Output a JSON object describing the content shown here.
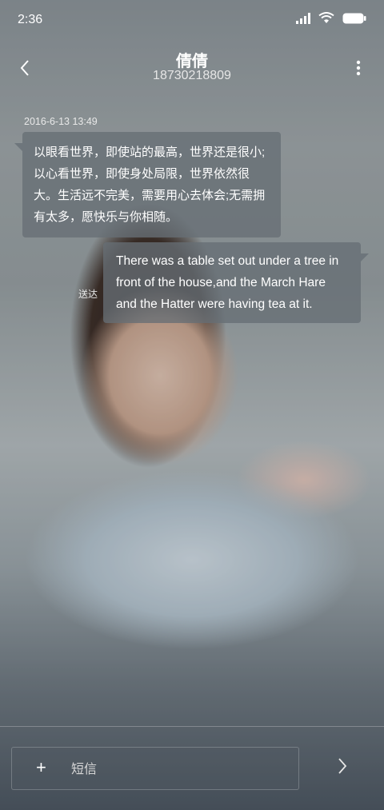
{
  "status_bar": {
    "time": "2:36",
    "icons": [
      "signal-icon",
      "wifi-icon",
      "battery-icon"
    ]
  },
  "header": {
    "contact_name": "倩倩",
    "phone_number": "18730218809",
    "back_icon": "chevron-left-icon",
    "more_icon": "vertical-dots-icon"
  },
  "conversation": {
    "timestamp": "2016-6-13 13:49",
    "messages": [
      {
        "direction": "incoming",
        "text": "以眼看世界，即使站的最高，世界还是很小;以心看世界，即使身处局限，世界依然很大。生活远不完美，需要用心去体会;无需拥有太多，愿快乐与你相随。"
      },
      {
        "direction": "outgoing",
        "status": "送达",
        "text": "There was a table set out under a tree in front of the house,and the March Hare and the Hatter were having tea at it."
      }
    ]
  },
  "composer": {
    "add_label": "+",
    "placeholder": "短信",
    "value": "",
    "send_icon": "chevron-right-icon"
  },
  "colors": {
    "bubble": "#666e74",
    "text": "#ffffff"
  }
}
